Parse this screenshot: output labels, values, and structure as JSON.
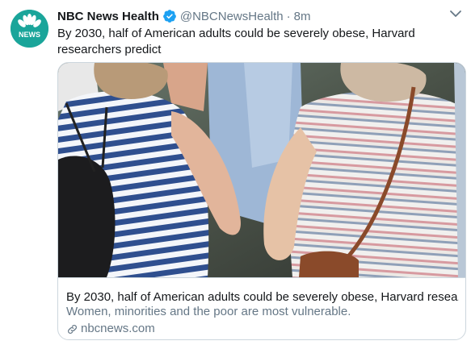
{
  "tweet": {
    "author_name": "NBC News Health",
    "handle": "@NBCNewsHealth",
    "separator": "·",
    "time": "8m",
    "text": "By 2030, half of American adults could be severely obese, Harvard researchers predict",
    "avatar_label": "NEWS"
  },
  "card": {
    "title": "By 2030, half of American adults could be severely obese, Harvard resea...",
    "description": "Women, minorities and the poor are most vulnerable.",
    "domain": "nbcnews.com"
  },
  "icons": {
    "avatar": "nbc-peacock-icon",
    "verified": "verified-badge-icon",
    "menu": "chevron-down-icon",
    "link": "link-icon"
  },
  "colors": {
    "avatar_bg": "#1aa59a",
    "verified": "#1da1f2",
    "secondary_text": "#657786",
    "border": "#ccd6dd"
  }
}
